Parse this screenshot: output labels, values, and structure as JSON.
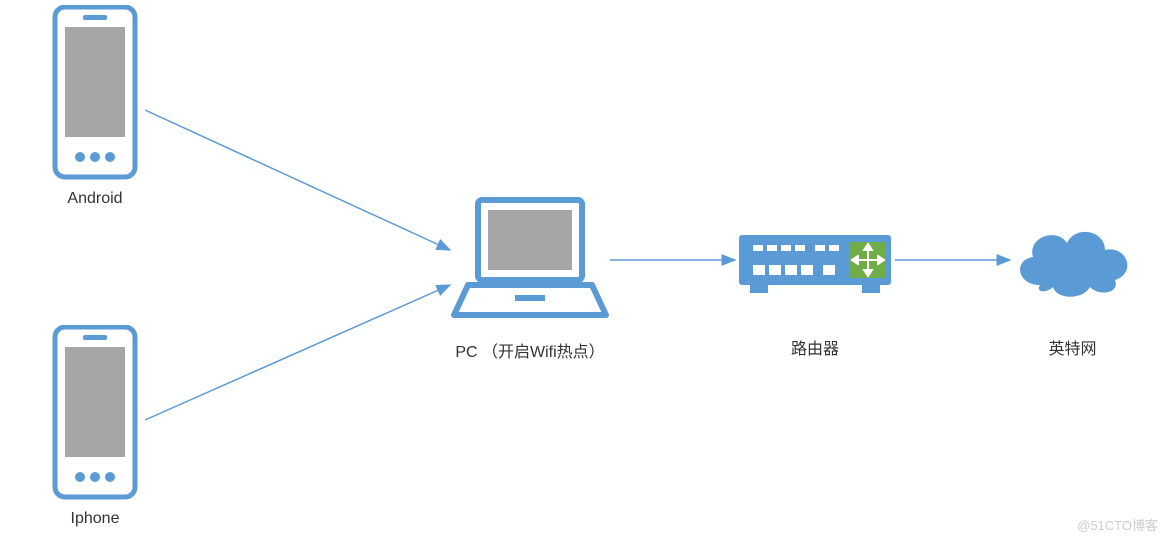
{
  "nodes": {
    "android": {
      "label": "Android"
    },
    "iphone": {
      "label": "Iphone"
    },
    "pc": {
      "label": "PC （开启Wifi热点）"
    },
    "router": {
      "label": "路由器"
    },
    "internet": {
      "label": "英特网"
    }
  },
  "watermark": "@51CTO博客",
  "colors": {
    "primary": "#5B9BD5",
    "screen": "#A6A6A6",
    "port": "#FFFFFF",
    "routerAccent": "#70AD47"
  }
}
